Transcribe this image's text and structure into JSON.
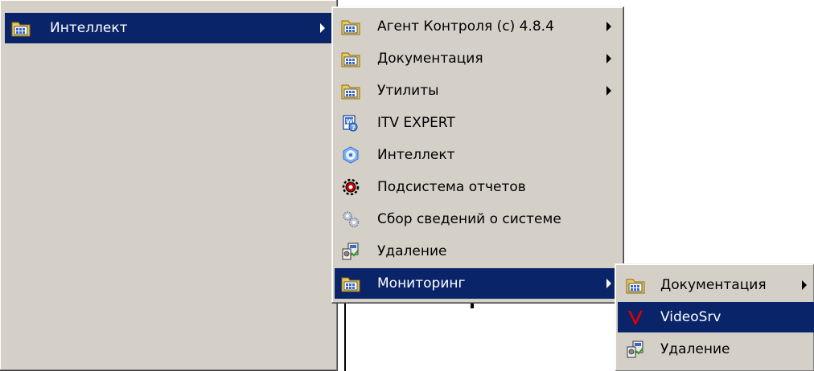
{
  "menu_root": {
    "items": [
      {
        "label": "Интеллект",
        "icon": "program-group-folder-icon",
        "submenu": true,
        "selected": true
      }
    ]
  },
  "menu_intellect": {
    "items": [
      {
        "label": "Агент Контроля (с) 4.8.4",
        "icon": "program-group-folder-icon",
        "submenu": true
      },
      {
        "label": "Документация",
        "icon": "program-group-folder-icon",
        "submenu": true
      },
      {
        "label": "Утилиты",
        "icon": "program-group-folder-icon",
        "submenu": true
      },
      {
        "label": "ITV EXPERT",
        "icon": "help-document-icon",
        "submenu": false
      },
      {
        "label": "Интеллект",
        "icon": "intellect-app-icon",
        "submenu": false
      },
      {
        "label": "Подсистема отчетов",
        "icon": "report-subsystem-icon",
        "submenu": false
      },
      {
        "label": "Сбор сведений о системе",
        "icon": "gears-icon",
        "submenu": false
      },
      {
        "label": "Удаление",
        "icon": "uninstall-icon",
        "submenu": false
      },
      {
        "label": "Мониторинг",
        "icon": "program-group-folder-icon",
        "submenu": true,
        "selected": true
      }
    ]
  },
  "menu_monitoring": {
    "items": [
      {
        "label": "Документация",
        "icon": "program-group-folder-icon",
        "submenu": true
      },
      {
        "label": "VideoSrv",
        "icon": "videosrv-v-icon",
        "submenu": false,
        "selected": true
      },
      {
        "label": "Удаление",
        "icon": "uninstall-icon",
        "submenu": false
      }
    ]
  },
  "colors": {
    "menu_bg": "#d4d0c8",
    "highlight": "#0a246a",
    "highlight_text": "#ffffff",
    "videosrv_red": "#e00000"
  }
}
